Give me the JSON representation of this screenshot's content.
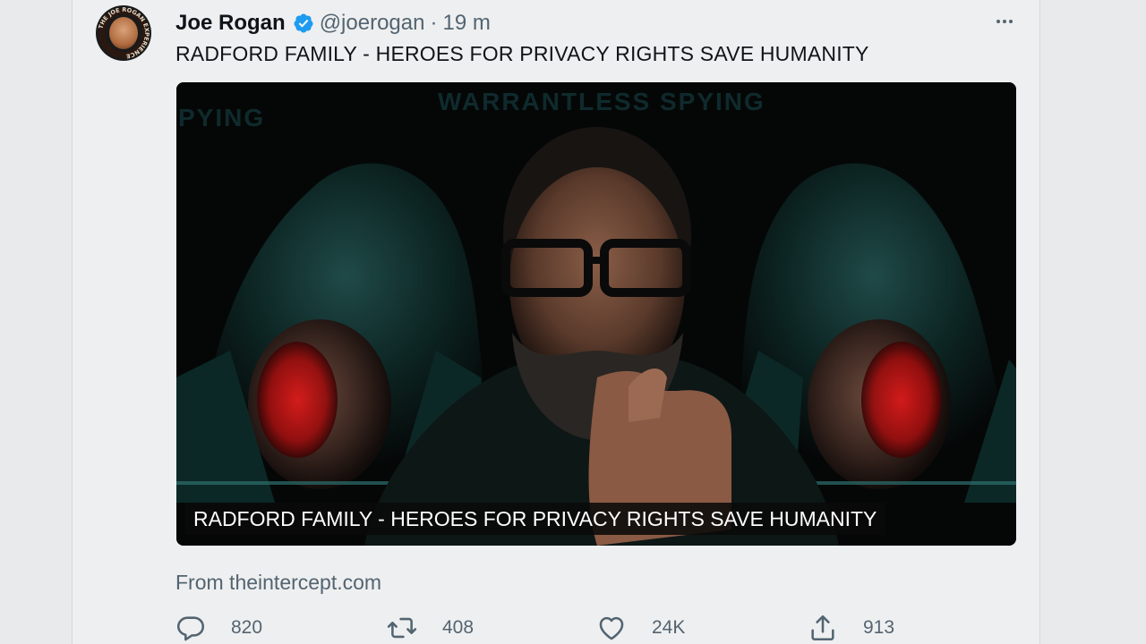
{
  "tweet": {
    "author_name": "Joe Rogan",
    "handle": "@joerogan",
    "separator": "·",
    "time": "19 m",
    "text": "RADFORD FAMILY - HEROES FOR PRIVACY RIGHTS SAVE HUMANITY",
    "verified": true,
    "avatar_ring_text": "THE JOE ROGAN EXPERIENCE"
  },
  "media": {
    "caption": "RADFORD FAMILY - HEROES FOR PRIVACY RIGHTS SAVE HUMANITY",
    "background_text": "WARRANTLESS SPYING",
    "background_text_left": "PYING"
  },
  "source": {
    "text": "From theintercept.com"
  },
  "actions": {
    "reply_count": "820",
    "retweet_count": "408",
    "like_count": "24K",
    "share_count": "913"
  },
  "icons": {
    "verified": "verified-badge-icon",
    "more": "more-icon",
    "reply": "reply-icon",
    "retweet": "retweet-icon",
    "like": "heart-icon",
    "share": "share-icon"
  },
  "colors": {
    "verified_blue": "#1d9bf0",
    "text_primary": "#0f1419",
    "text_secondary": "#536471"
  }
}
